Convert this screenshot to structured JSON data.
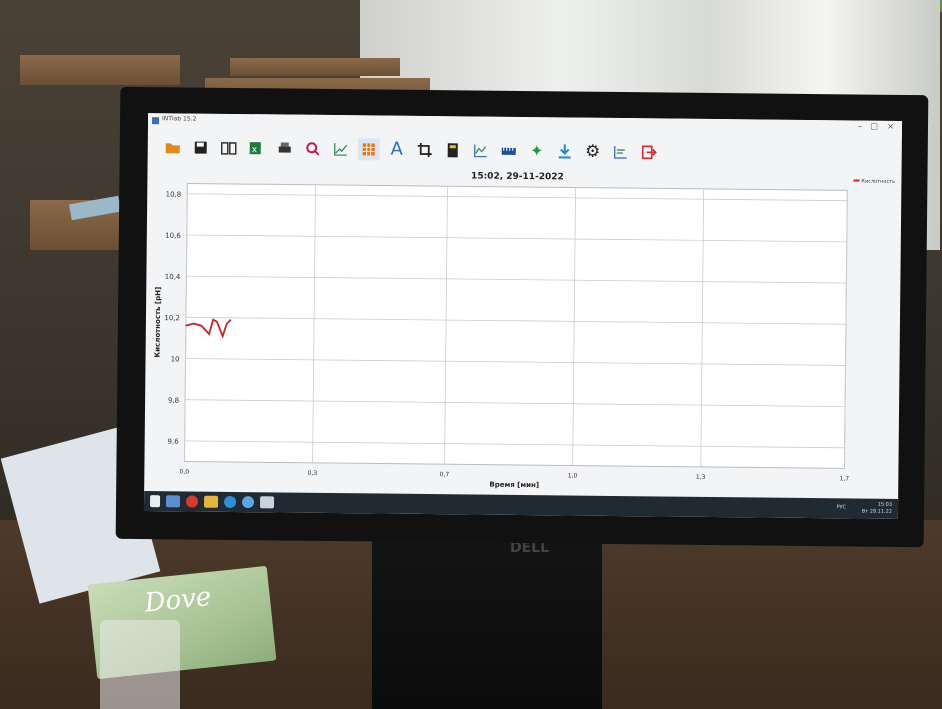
{
  "app": {
    "title": "INTlab 15.2",
    "window_controls": [
      "–",
      "□",
      "×"
    ]
  },
  "toolbar": {
    "icons": [
      "open-folder-icon",
      "save-icon",
      "book-icon",
      "excel-export-icon",
      "print-icon",
      "zoom-icon",
      "line-chart-icon",
      "table-grid-icon",
      "text-icon",
      "crop-icon",
      "calculator-icon",
      "chart-options-icon",
      "sensor-icon",
      "run-icon",
      "download-icon",
      "settings-icon",
      "chart-settings-icon",
      "exit-icon"
    ]
  },
  "chart_data": {
    "type": "line",
    "title": "15:02, 29-11-2022",
    "xlabel": "Время [мин]",
    "ylabel": "Кислотность [pH]",
    "xlim": [
      0.0,
      1.7
    ],
    "ylim": [
      9.5,
      10.85
    ],
    "x_ticks": [
      "0,0",
      "0,3",
      "0,7",
      "1,0",
      "1,3",
      "1,7"
    ],
    "x_tick_values": [
      0.0,
      0.33,
      0.67,
      1.0,
      1.33,
      1.7
    ],
    "y_ticks": [
      "10,8",
      "10,6",
      "10,4",
      "10,2",
      "10",
      "9,8",
      "9,6"
    ],
    "y_tick_values": [
      10.8,
      10.6,
      10.4,
      10.2,
      10.0,
      9.8,
      9.6
    ],
    "grid": true,
    "legend_position": "top-right",
    "series": [
      {
        "name": "Кислотность",
        "color": "#cc2222",
        "x": [
          0.0,
          0.02,
          0.04,
          0.06,
          0.07,
          0.08,
          0.095,
          0.105,
          0.115
        ],
        "y": [
          10.16,
          10.17,
          10.16,
          10.12,
          10.19,
          10.18,
          10.11,
          10.17,
          10.19
        ]
      }
    ]
  },
  "taskbar": {
    "language": "РУС",
    "time": "15:03",
    "date": "Вт 29.11.22"
  },
  "photo": {
    "soap_brand": "Dove",
    "monitor_brand": "DELL"
  }
}
